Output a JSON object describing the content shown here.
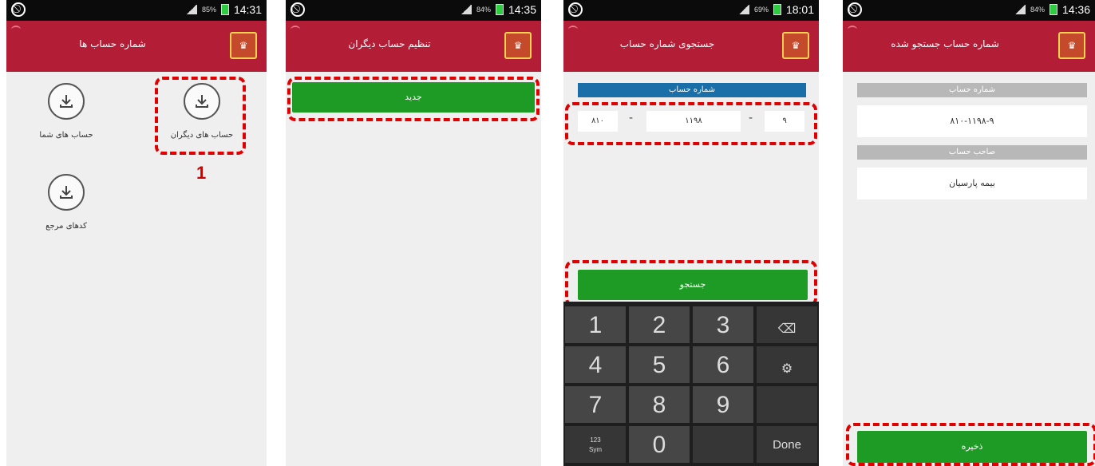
{
  "phones": [
    {
      "status_time": "14:31",
      "status_pct": "85%",
      "title": "شماره حساب ها",
      "items": [
        "حساب های دیگران",
        "حساب های شما",
        "کدهای مرجع"
      ],
      "annotation": "1"
    },
    {
      "status_time": "14:35",
      "status_pct": "84%",
      "title": "تنظیم حساب دیگران",
      "new_button": "جدید"
    },
    {
      "status_time": "18:01",
      "status_pct": "69%",
      "title": "جستجوی شماره حساب",
      "field_header": "شماره حساب",
      "fields": [
        "۸۱۰",
        "۱۱۹۸",
        "۹"
      ],
      "separator": "-",
      "search_button": "جستجو",
      "keys": [
        "1",
        "2",
        "3",
        "4",
        "5",
        "6",
        "7",
        "8",
        "9",
        "0"
      ],
      "key_sym_top": "123",
      "key_sym_bottom": "Sym",
      "key_done": "Done"
    },
    {
      "status_time": "14:36",
      "status_pct": "84%",
      "title": "شماره حساب جستجو شده",
      "account_header": "شماره حساب",
      "account_value": "۸۱۰-۱۱۹۸-۹",
      "owner_header": "صاحب حساب",
      "owner_value": "بیمه پارسیان",
      "save_button": "ذخیره"
    }
  ],
  "colors": {
    "title_bar": "#b31d36",
    "green_button": "#1e9b24",
    "blue_header": "#1a6fa8",
    "annotation_red": "#e00000"
  }
}
